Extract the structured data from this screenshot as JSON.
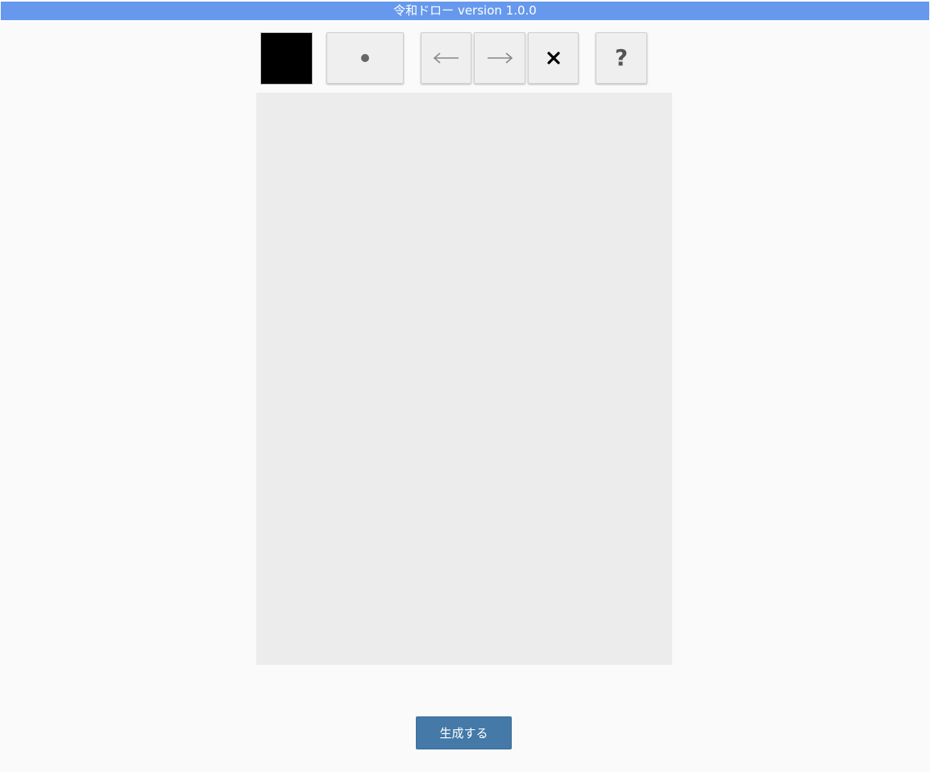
{
  "header": {
    "title": "令和ドロー version 1.0.0",
    "background_color": "#6699ee"
  },
  "toolbar": {
    "current_color": "#000000",
    "brush": {
      "icon": "dot-icon",
      "icon_color": "#666666"
    },
    "undo": {
      "icon": "arrow-left-icon",
      "icon_color": "#888888"
    },
    "redo": {
      "icon": "arrow-right-icon",
      "icon_color": "#888888"
    },
    "clear": {
      "icon": "close-icon",
      "icon_color": "#000000"
    },
    "help": {
      "label": "?",
      "icon": "question-icon",
      "icon_color": "#555555"
    }
  },
  "canvas": {
    "background_color": "#ececec"
  },
  "generate": {
    "label": "生成する",
    "background_color": "#4479a8"
  }
}
